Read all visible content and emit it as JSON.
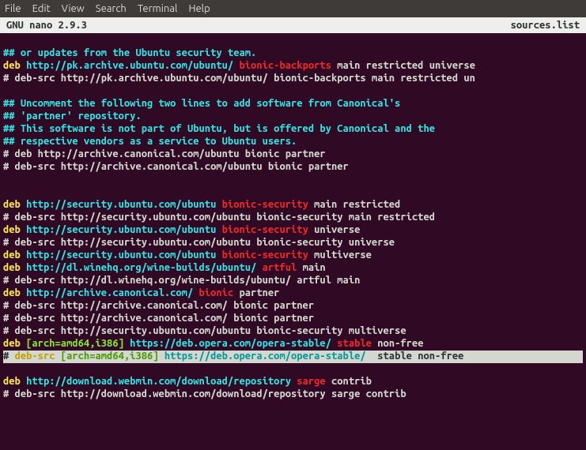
{
  "menu": {
    "items": [
      "File",
      "Edit",
      "View",
      "Search",
      "Terminal",
      "Help"
    ]
  },
  "titlebar": {
    "app": "GNU nano 2.9.3",
    "file": "sources.list"
  },
  "lines": [
    {
      "tokens": []
    },
    {
      "tokens": [
        {
          "t": "## or updates from the Ubuntu security team.",
          "c": "cyan"
        }
      ]
    },
    {
      "tokens": [
        {
          "t": "deb ",
          "c": "yellow"
        },
        {
          "t": "http://pk.archive.ubuntu.com/ubuntu/ ",
          "c": "cyan"
        },
        {
          "t": "bionic-backports ",
          "c": "red"
        },
        {
          "t": "main restricted universe",
          "c": "white"
        }
      ]
    },
    {
      "tokens": [
        {
          "t": "# deb-src http://pk.archive.ubuntu.com/ubuntu/ bionic-backports main restricted un",
          "c": "white"
        }
      ]
    },
    {
      "tokens": []
    },
    {
      "tokens": [
        {
          "t": "## Uncomment the following two lines to add software from Canonical's",
          "c": "cyan"
        }
      ]
    },
    {
      "tokens": [
        {
          "t": "## 'partner' repository.",
          "c": "cyan"
        }
      ]
    },
    {
      "tokens": [
        {
          "t": "## This software is not part of Ubuntu, but is offered by Canonical and the",
          "c": "cyan"
        }
      ]
    },
    {
      "tokens": [
        {
          "t": "## respective vendors as a service to Ubuntu users.",
          "c": "cyan"
        }
      ]
    },
    {
      "tokens": [
        {
          "t": "# deb http://archive.canonical.com/ubuntu bionic partner",
          "c": "white"
        }
      ]
    },
    {
      "tokens": [
        {
          "t": "# deb-src http://archive.canonical.com/ubuntu bionic partner",
          "c": "white"
        }
      ]
    },
    {
      "tokens": []
    },
    {
      "tokens": []
    },
    {
      "tokens": [
        {
          "t": "deb ",
          "c": "yellow"
        },
        {
          "t": "http://security.ubuntu.com/ubuntu ",
          "c": "cyan"
        },
        {
          "t": "bionic-security ",
          "c": "red"
        },
        {
          "t": "main restricted",
          "c": "white"
        }
      ]
    },
    {
      "tokens": [
        {
          "t": "# deb-src http://security.ubuntu.com/ubuntu bionic-security main restricted",
          "c": "white"
        }
      ]
    },
    {
      "tokens": [
        {
          "t": "deb ",
          "c": "yellow"
        },
        {
          "t": "http://security.ubuntu.com/ubuntu ",
          "c": "cyan"
        },
        {
          "t": "bionic-security ",
          "c": "red"
        },
        {
          "t": "universe",
          "c": "white"
        }
      ]
    },
    {
      "tokens": [
        {
          "t": "# deb-src http://security.ubuntu.com/ubuntu bionic-security universe",
          "c": "white"
        }
      ]
    },
    {
      "tokens": [
        {
          "t": "deb ",
          "c": "yellow"
        },
        {
          "t": "http://security.ubuntu.com/ubuntu ",
          "c": "cyan"
        },
        {
          "t": "bionic-security ",
          "c": "red"
        },
        {
          "t": "multiverse",
          "c": "white"
        }
      ]
    },
    {
      "tokens": [
        {
          "t": "deb ",
          "c": "yellow"
        },
        {
          "t": "http://dl.winehq.org/wine-builds/ubuntu/ ",
          "c": "cyan"
        },
        {
          "t": "artful ",
          "c": "red"
        },
        {
          "t": "main",
          "c": "white"
        }
      ]
    },
    {
      "tokens": [
        {
          "t": "# deb-src http://dl.winehq.org/wine-builds/ubuntu/ artful main",
          "c": "white"
        }
      ]
    },
    {
      "tokens": [
        {
          "t": "deb ",
          "c": "yellow"
        },
        {
          "t": "http://archive.canonical.com/ ",
          "c": "cyan"
        },
        {
          "t": "bionic ",
          "c": "red"
        },
        {
          "t": "partner",
          "c": "white"
        }
      ]
    },
    {
      "tokens": [
        {
          "t": "# deb-src http://archive.canonical.com/ bionic partner",
          "c": "white"
        }
      ]
    },
    {
      "tokens": [
        {
          "t": "# deb-src http://archive.canonical.com/ bionic partner",
          "c": "white"
        }
      ]
    },
    {
      "tokens": [
        {
          "t": "# deb-src http://security.ubuntu.com/ubuntu bionic-security multiverse",
          "c": "white"
        }
      ]
    },
    {
      "tokens": [
        {
          "t": "deb ",
          "c": "yellow"
        },
        {
          "t": "[arch=amd64,i386] ",
          "c": "green"
        },
        {
          "t": "https://deb.opera.com/opera-stable/ ",
          "c": "cyan"
        },
        {
          "t": "stable ",
          "c": "red"
        },
        {
          "t": "non-free",
          "c": "white"
        }
      ]
    },
    {
      "hl": true,
      "tokens": [
        {
          "t": "# ",
          "c": "white"
        },
        {
          "t": "deb-src ",
          "c": "yellow"
        },
        {
          "t": "[arch=amd64,i386] ",
          "c": "green"
        },
        {
          "t": "https://deb.opera.com/opera-stable/ ",
          "c": "cyan"
        },
        {
          "t": " stable non-free",
          "c": "white"
        }
      ]
    },
    {
      "tokens": []
    },
    {
      "tokens": [
        {
          "t": "deb ",
          "c": "yellow"
        },
        {
          "t": "http://download.webmin.com/download/repository ",
          "c": "cyan"
        },
        {
          "t": "sarge ",
          "c": "red"
        },
        {
          "t": "contrib",
          "c": "white"
        }
      ]
    },
    {
      "tokens": [
        {
          "t": "# deb-src http://download.webmin.com/download/repository sarge contrib",
          "c": "white"
        }
      ]
    }
  ]
}
